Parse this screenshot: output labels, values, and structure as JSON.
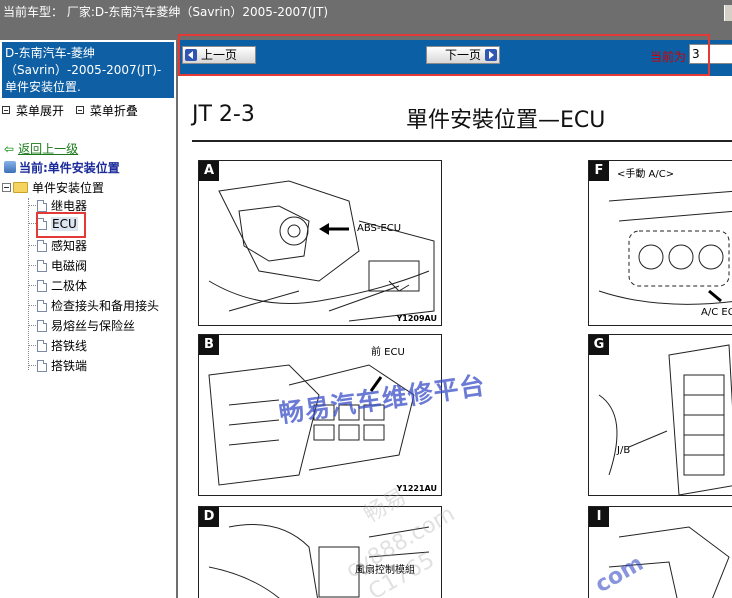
{
  "titlebar": {
    "title": "当前车型：  厂家:D-东南汽车菱绅（Savrin）2005-2007(JT)"
  },
  "sidebar": {
    "car_header": "D-东南汽车-菱绅（Savrin）-2005-2007(JT)- 单件安装位置.",
    "expand_label": "菜单展开",
    "collapse_label": "菜单折叠",
    "back_label": "返回上一级",
    "current_label": "当前:单件安装位置",
    "folder_label": "单件安装位置",
    "items": [
      {
        "label": "继电器"
      },
      {
        "label": "ECU"
      },
      {
        "label": "感知器"
      },
      {
        "label": "电磁阀"
      },
      {
        "label": "二极体"
      },
      {
        "label": "检查接头和备用接头"
      },
      {
        "label": "易熔丝与保险丝"
      },
      {
        "label": "搭铁线"
      },
      {
        "label": "搭铁端"
      }
    ]
  },
  "nav": {
    "prev_label": "上一页",
    "next_label": "下一页",
    "page_label": "当前为",
    "page_value": "3"
  },
  "document": {
    "page_code": "JT 2-3",
    "title": "單件安裝位置—ECU",
    "panels": [
      {
        "letter": "A",
        "annotation": "ABS-ECU",
        "code": "Y1209AU"
      },
      {
        "letter": "F",
        "annotation": "<手動 A/C>",
        "annotation2": "A/C ECU"
      },
      {
        "letter": "B",
        "annotation": "前 ECU",
        "code": "Y1221AU"
      },
      {
        "letter": "G",
        "annotation": "J/B"
      },
      {
        "letter": "D",
        "annotation": "風扇控制模組"
      },
      {
        "letter": "I"
      }
    ],
    "watermark": "畅易汽车维修平台",
    "watermark_faint_1": "畅易",
    "watermark_faint_2": "cy888.com",
    "watermark_faint_3": "C1765",
    "watermark_corner": "com"
  }
}
